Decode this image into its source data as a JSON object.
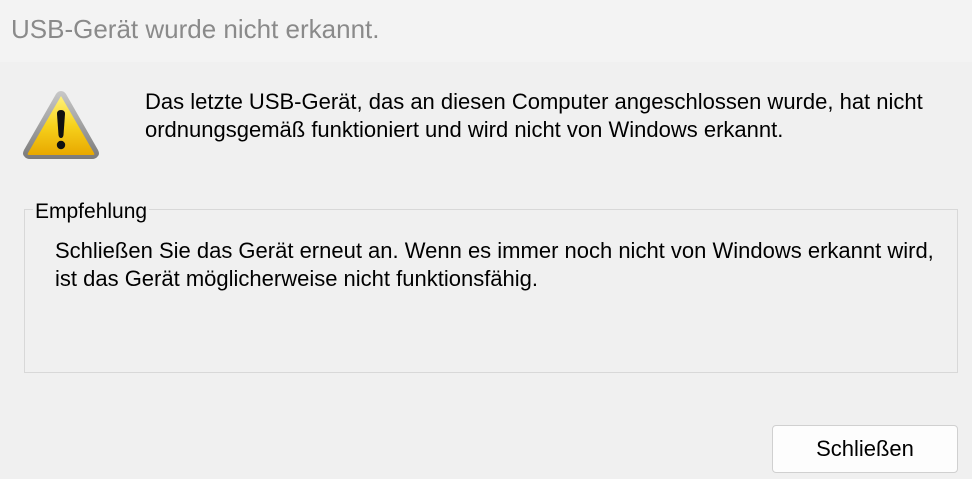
{
  "window": {
    "title": "USB-Gerät wurde nicht erkannt."
  },
  "dialog": {
    "icon": "warning-icon",
    "message": "Das letzte USB-Gerät, das an diesen Computer angeschlossen wurde, hat nicht ordnungsgemäß funktioniert und wird nicht von Windows erkannt."
  },
  "recommendation": {
    "heading": "Empfehlung",
    "text": "Schließen Sie das Gerät erneut an. Wenn es immer noch nicht von Windows erkannt wird, ist das Gerät möglicherweise nicht funktionsfähig."
  },
  "buttons": {
    "close_label": "Schließen"
  },
  "colors": {
    "warning_yellow": "#f5c400",
    "warning_border": "#8a8a8a",
    "background": "#f0f0f0",
    "title_text": "#8a8a8a"
  }
}
